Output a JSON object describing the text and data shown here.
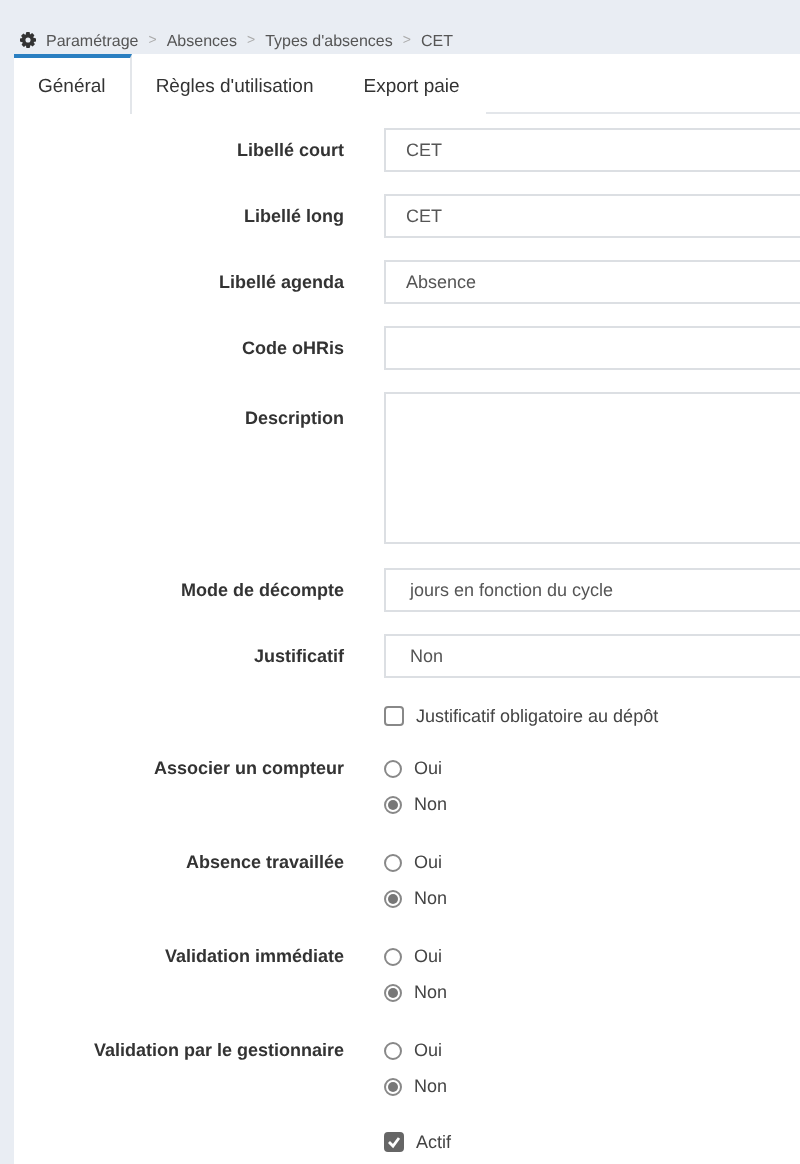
{
  "breadcrumb": [
    "Paramétrage",
    "Absences",
    "Types d'absences",
    "CET"
  ],
  "breadcrumb_separator": ">",
  "tabs": [
    {
      "label": "Général",
      "selected": true
    },
    {
      "label": "Règles d'utilisation",
      "selected": false
    },
    {
      "label": "Export paie",
      "selected": false
    }
  ],
  "fields": [
    {
      "kind": "text",
      "label": "Libellé court",
      "value": "CET"
    },
    {
      "kind": "text",
      "label": "Libellé long",
      "value": "CET"
    },
    {
      "kind": "text",
      "label": "Libellé agenda",
      "value": "Absence"
    },
    {
      "kind": "text",
      "label": "Code oHRis"
    },
    {
      "kind": "textarea",
      "label": "Description"
    },
    {
      "kind": "select",
      "label": "Mode de décompte",
      "value": "jours en fonction du cycle"
    },
    {
      "kind": "select",
      "label": "Justificatif",
      "value": "Non"
    },
    {
      "kind": "checkbox",
      "text": "Justificatif obligatoire au dépôt",
      "checked": false
    },
    {
      "kind": "radio",
      "label": "Associer un compteur",
      "options": [
        {
          "text": "Oui",
          "selected": false
        },
        {
          "text": "Non",
          "selected": true
        }
      ]
    },
    {
      "kind": "radio",
      "label": "Absence travaillée",
      "options": [
        {
          "text": "Oui",
          "selected": false
        },
        {
          "text": "Non",
          "selected": true
        }
      ]
    },
    {
      "kind": "radio",
      "label": "Validation immédiate",
      "options": [
        {
          "text": "Oui",
          "selected": false
        },
        {
          "text": "Non",
          "selected": true
        }
      ]
    },
    {
      "kind": "radio",
      "label": "Validation par le gestionnaire",
      "options": [
        {
          "text": "Oui",
          "selected": false
        },
        {
          "text": "Non",
          "selected": true
        }
      ]
    },
    {
      "kind": "checkbox",
      "text": "Actif",
      "checked": true
    }
  ]
}
